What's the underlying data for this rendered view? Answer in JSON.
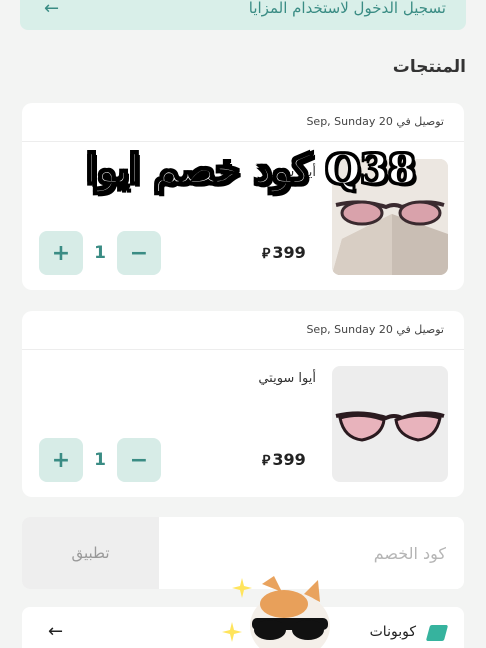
{
  "login_banner": {
    "text": "تسجيل الدخول لاستخدام المزايا",
    "arrow": "←"
  },
  "products_title": "المنتجات",
  "items": [
    {
      "delivery": "توصيل في 20 Sep, Sunday",
      "name": "أيوا سوديا",
      "price": "399",
      "currency": "⃁",
      "quantity": "1"
    },
    {
      "delivery": "توصيل في 20 Sep, Sunday",
      "name": "أيوا سويتي",
      "price": "399",
      "currency": "⃁",
      "quantity": "1"
    }
  ],
  "qty_minus": "−",
  "qty_plus": "+",
  "coupon": {
    "placeholder": "كود الخصم",
    "apply_label": "تطبيق"
  },
  "coupons_row": {
    "label": "كوبونات",
    "arrow": "←",
    "icon": "tag-icon"
  },
  "overlay_text": "كود خصم ايوا Q38",
  "colors": {
    "accent": "#3a8c84",
    "accent_bg": "#d7ece7",
    "banner_bg": "#d9efe9"
  }
}
